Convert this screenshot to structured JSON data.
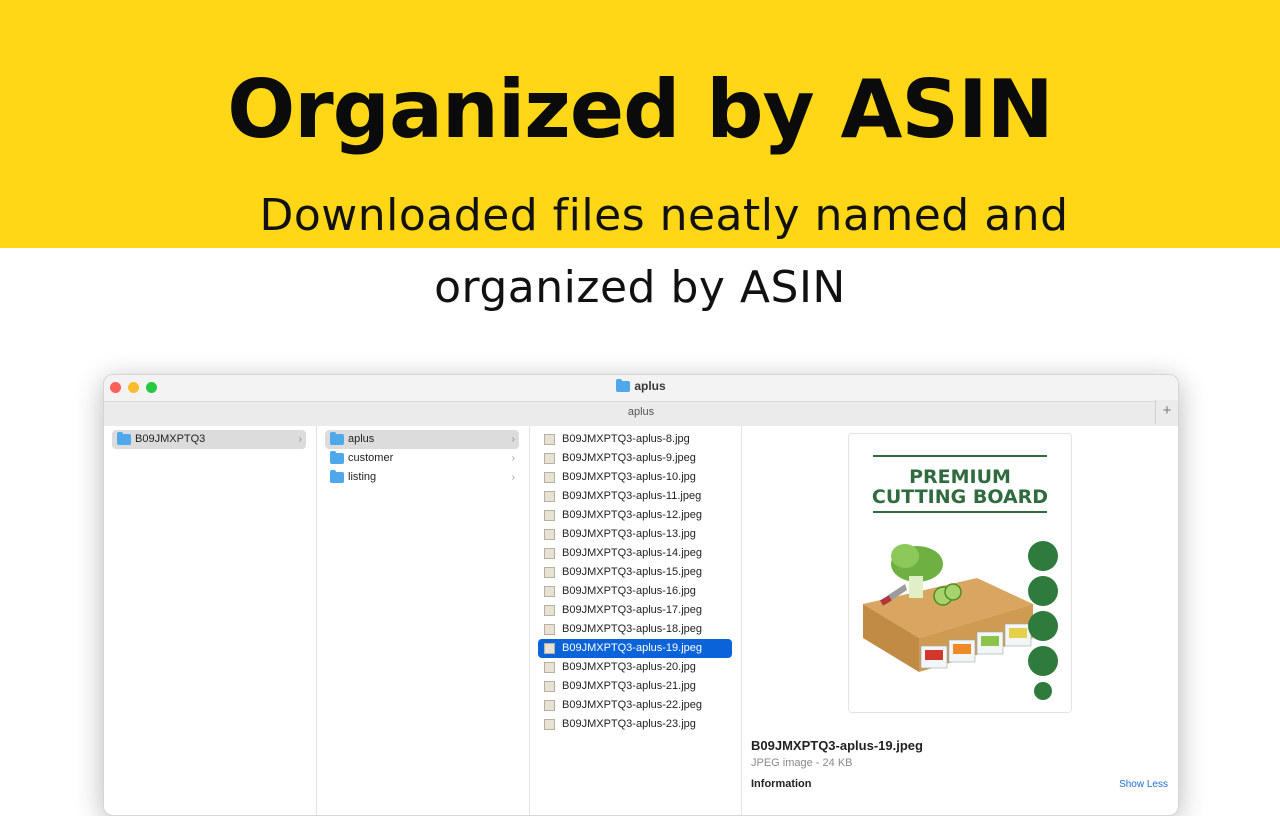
{
  "banner": {
    "headline": "Organized by ASIN",
    "subtitle_line1": "Downloaded files neatly named and",
    "subtitle_line2": "organized by ASIN",
    "color": "#FFD716"
  },
  "window": {
    "title": "aplus",
    "path": "aplus",
    "add_button": "+"
  },
  "columns": {
    "col1": [
      {
        "label": "B09JMXPTQ3",
        "selected": true,
        "icon": "folder-icon"
      }
    ],
    "col2": [
      {
        "label": "aplus",
        "selected": true,
        "icon": "folder-icon"
      },
      {
        "label": "customer",
        "selected": false,
        "icon": "folder-icon"
      },
      {
        "label": "listing",
        "selected": false,
        "icon": "folder-icon"
      }
    ],
    "files": [
      "B09JMXPTQ3-aplus-8.jpg",
      "B09JMXPTQ3-aplus-9.jpeg",
      "B09JMXPTQ3-aplus-10.jpg",
      "B09JMXPTQ3-aplus-11.jpeg",
      "B09JMXPTQ3-aplus-12.jpeg",
      "B09JMXPTQ3-aplus-13.jpg",
      "B09JMXPTQ3-aplus-14.jpeg",
      "B09JMXPTQ3-aplus-15.jpeg",
      "B09JMXPTQ3-aplus-16.jpg",
      "B09JMXPTQ3-aplus-17.jpeg",
      "B09JMXPTQ3-aplus-18.jpeg",
      "B09JMXPTQ3-aplus-19.jpeg",
      "B09JMXPTQ3-aplus-20.jpg",
      "B09JMXPTQ3-aplus-21.jpg",
      "B09JMXPTQ3-aplus-22.jpeg",
      "B09JMXPTQ3-aplus-23.jpg"
    ],
    "selected_file": "B09JMXPTQ3-aplus-19.jpeg"
  },
  "preview": {
    "image_heading_line1": "PREMIUM",
    "image_heading_line2": "CUTTING BOARD",
    "file_name": "B09JMXPTQ3-aplus-19.jpeg",
    "file_meta": "JPEG image - 24 KB",
    "info_label": "Information",
    "show_less": "Show Less"
  }
}
